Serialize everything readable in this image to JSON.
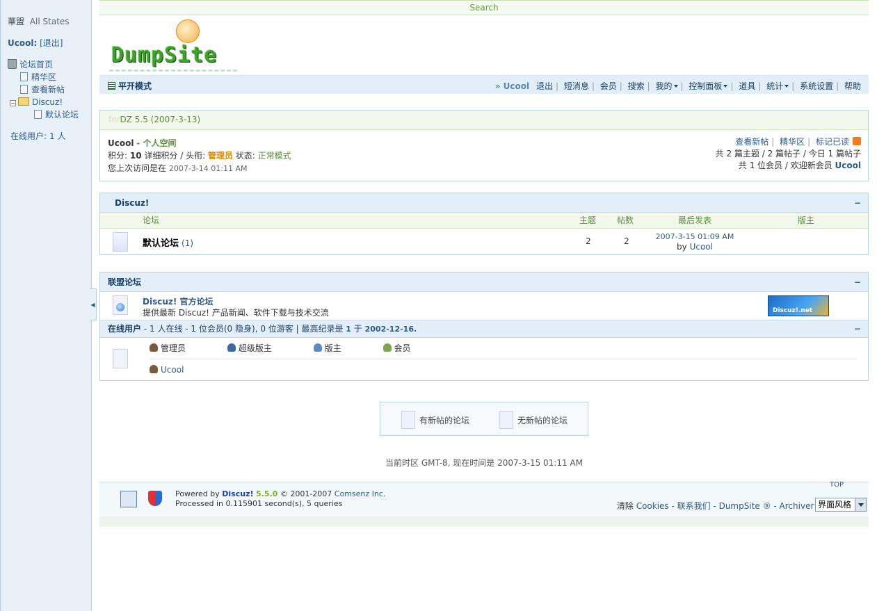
{
  "sidebar": {
    "org_title": "華盟",
    "org_sub": "All States",
    "username": "Ucool:",
    "logout": "[退出]",
    "tree": {
      "home": "论坛首页",
      "digest": "精华区",
      "new_posts": "查看新帖",
      "group": "Discuz!",
      "default_forum": "默认论坛"
    },
    "online_label": "在线用户:",
    "online_count": "1 人"
  },
  "searchbar": {
    "label": "Search"
  },
  "logo": {
    "text": "DumpSite"
  },
  "navbar": {
    "mode": "平开模式",
    "current_user": "» Ucool",
    "items": [
      "退出",
      "短消息",
      "会员",
      "搜索",
      "我的",
      "控制面板",
      "道具",
      "统计",
      "系统设置",
      "帮助"
    ]
  },
  "info": {
    "header_faint": "for",
    "header": "DZ 5.5 (2007-3-13)",
    "username": "Ucool",
    "space": "- 个人空间",
    "points_label": "积分:",
    "points": "10",
    "points_detail": "详细积分 / 头衔:",
    "title": "管理员",
    "status_label": "状态:",
    "status": "正常模式",
    "last_visit_label": "您上次访问是在",
    "last_visit": "2007-3-14 01:11 AM",
    "links": [
      "查看新帖",
      "精华区",
      "标记已读"
    ],
    "stats_line": "共 2 篇主题 / 2 篇帖子 / 今日 1 篇帖子",
    "members_line": "共 1 位会员 / 欢迎新会员",
    "new_member": "Ucool"
  },
  "forum": {
    "category": "Discuz!",
    "collapse": "−",
    "columns": {
      "forum": "论坛",
      "topics": "主题",
      "posts": "帖数",
      "last": "最后发表",
      "mods": "版主"
    },
    "rows": [
      {
        "name": "默认论坛",
        "today": "(1)",
        "topics": "2",
        "posts": "2",
        "last_date": "2007-3-15 01:09 AM",
        "last_by": "by",
        "last_user": "Ucool"
      }
    ]
  },
  "league": {
    "category": "联盟论坛",
    "collapse": "−",
    "name": "Discuz! 官方论坛",
    "desc": "提供最新 Discuz! 产品新闻、软件下载与技术交流",
    "banner": "Discuz!.net"
  },
  "online": {
    "title": "在线用户",
    "summary_1": "- 1 人在线",
    "summary_2": "- 1 位会员(0 隐身), 0 位游客",
    "record_label": "| 最高纪录是",
    "record_count": "1",
    "record_at": "于",
    "record_date": "2002-12-16.",
    "collapse": "−",
    "legend": [
      "管理员",
      "超级版主",
      "版主",
      "会员"
    ],
    "users": [
      "Ucool"
    ]
  },
  "status_legend": {
    "new": "有新帖的论坛",
    "nonew": "无新帖的论坛"
  },
  "timezone": "当前时区 GMT-8, 现在时间是 2007-3-15 01:11 AM",
  "footer": {
    "powered": "Powered by",
    "brand": "Discuz!",
    "version": "5.5.0",
    "copyright": "© 2001-2007",
    "company": "Comsenz Inc.",
    "processed": "Processed in 0.115901 second(s), 5 queries",
    "clear": "清除",
    "links": "Cookies - 联系我们 - DumpSite ® - Archiver - WAP",
    "style_select": "界面风格",
    "top": "TOP"
  }
}
